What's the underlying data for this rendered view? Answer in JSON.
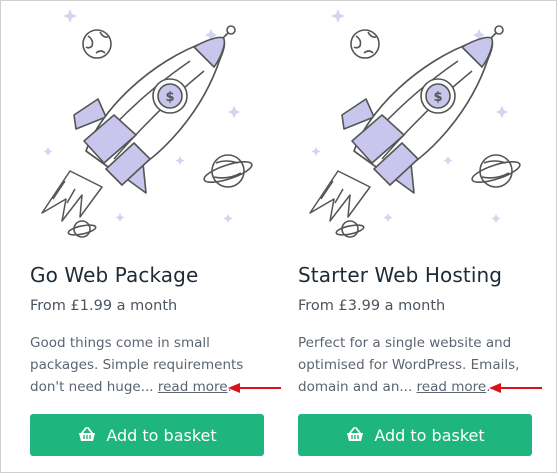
{
  "products": [
    {
      "title": "Go Web Package",
      "price": "From £1.99 a month",
      "description": "Good things come in small packages. Simple requirements don't need huge...",
      "more_link": "read more",
      "more_suffix": ".",
      "button_label": "Add to basket",
      "icon": "basket-icon",
      "illustration": "rocket-illustration"
    },
    {
      "title": "Starter Web Hosting",
      "price": "From £3.99 a month",
      "description": "Perfect for a single website and optimised for WordPress. Emails, domain and an...",
      "more_link": "read more",
      "more_suffix": ".",
      "button_label": "Add to basket",
      "icon": "basket-icon",
      "illustration": "rocket-illustration"
    }
  ],
  "colors": {
    "button": "#1fb57f",
    "annotation_arrow": "#d8121b",
    "rocket_accent": "#c8c6ec",
    "title_text": "#202b36"
  }
}
